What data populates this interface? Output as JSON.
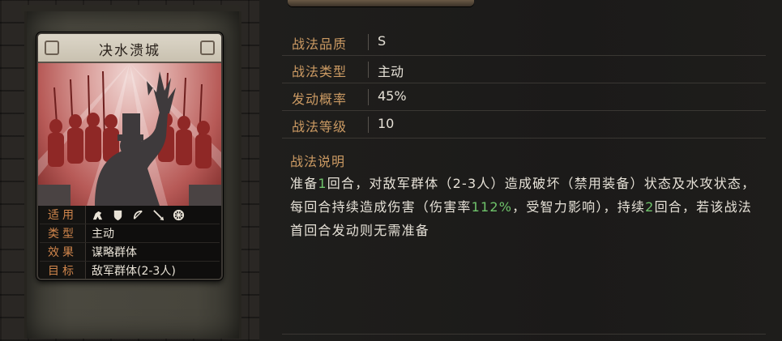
{
  "card": {
    "title": "决水溃城",
    "rows": [
      {
        "label": "适用",
        "icons": [
          "cavalry-icon",
          "shield-icon",
          "bow-icon",
          "spear-icon",
          "wheel-icon"
        ]
      },
      {
        "label": "类型",
        "value": "主动"
      },
      {
        "label": "效果",
        "value": "谋略群体"
      },
      {
        "label": "目标",
        "value": "敌军群体(2-3人)"
      }
    ]
  },
  "attributes": [
    {
      "label": "战法品质",
      "value": "S"
    },
    {
      "label": "战法类型",
      "value": "主动"
    },
    {
      "label": "发动概率",
      "value": "45%"
    },
    {
      "label": "战法等级",
      "value": "10"
    }
  ],
  "description": {
    "title": "战法说明",
    "segments": [
      {
        "text": "准备",
        "hl": false
      },
      {
        "text": "1",
        "hl": true
      },
      {
        "text": "回合，对敌军群体（2-3人）造成破坏（禁用装备）状态及水攻状态，每回合持续造成伤害（伤害率",
        "hl": false
      },
      {
        "text": "112%",
        "hl": true
      },
      {
        "text": "，受智力影响），持续",
        "hl": false
      },
      {
        "text": "2",
        "hl": true
      },
      {
        "text": "回合，若该战法首回合发动则无需准备",
        "hl": false
      }
    ]
  },
  "colors": {
    "label": "#cb9a63",
    "highlight": "#6fc46b",
    "card_label": "#d1864c"
  }
}
